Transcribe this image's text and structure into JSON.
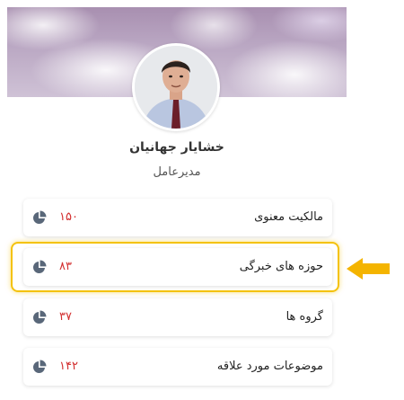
{
  "profile": {
    "name": "خشایار جهانیان",
    "role": "مدیرعامل"
  },
  "stats": [
    {
      "label": "مالکیت معنوی",
      "count": "۱۵۰",
      "icon": "pie-chart-icon"
    },
    {
      "label": "حوزه های خبرگی",
      "count": "۸۳",
      "icon": "pie-chart-icon",
      "highlighted": true
    },
    {
      "label": "گروه ها",
      "count": "۳۷",
      "icon": "pie-chart-icon"
    },
    {
      "label": "موضوعات مورد علاقه",
      "count": "۱۴۲",
      "icon": "pie-chart-icon"
    }
  ],
  "colors": {
    "count": "#d32f2f",
    "highlight": "#f4c20d",
    "icon": "#596779"
  }
}
